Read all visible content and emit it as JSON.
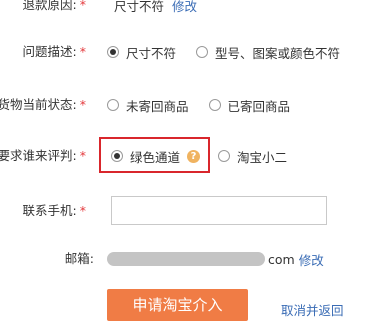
{
  "refund_reason": {
    "label": "退款原因:",
    "value": "尺寸不符",
    "edit": "修改"
  },
  "issue_desc": {
    "label": "问题描述:",
    "options": [
      "尺寸不符",
      "型号、图案或颜色不符"
    ],
    "selected": 0
  },
  "goods_status": {
    "label": "货物当前状态:",
    "options": [
      "未寄回商品",
      "已寄回商品"
    ],
    "selected": -1
  },
  "judge": {
    "label": "要求谁来评判:",
    "options": [
      "绿色通道",
      "淘宝小二"
    ],
    "selected": 0,
    "help": "?"
  },
  "phone": {
    "label": "联系手机:",
    "value": ""
  },
  "email": {
    "label": "邮箱:",
    "suffix": "com",
    "edit": "修改"
  },
  "actions": {
    "submit": "申请淘宝介入",
    "cancel": "取消并返回"
  },
  "colors": {
    "required_star": "#e4393c",
    "link": "#3a6cb5",
    "highlight": "#d9262c",
    "button": "#f07c45"
  }
}
